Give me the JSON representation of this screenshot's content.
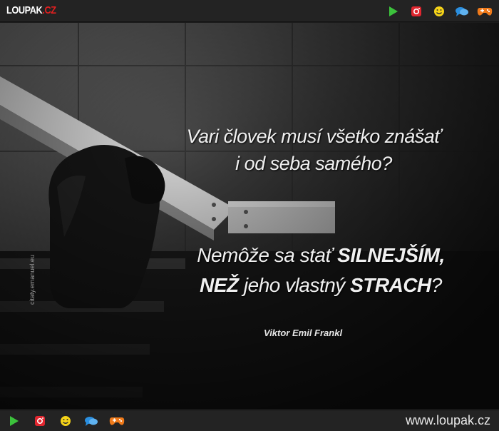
{
  "header": {
    "logo_main": "LOUPAK",
    "logo_suffix": ".CZ",
    "icons": [
      "play-icon",
      "instagram-icon",
      "smiley-icon",
      "chat-icon",
      "gamepad-icon"
    ]
  },
  "post": {
    "quote_line1": "Vari človek musí všetko znášať",
    "quote_line2": "i od seba samého?",
    "quote2_part1": "Nemôže sa stať ",
    "quote2_bold1": "SILNEJŠÍM,",
    "quote2_bold2": "NEŽ",
    "quote2_part2": " jeho vlastný ",
    "quote2_bold3": "STRACH",
    "quote2_end": "?",
    "author": "Viktor Emil Frankl",
    "watermark": "citaty.emanuel.eu"
  },
  "footer": {
    "site_url": "www.loupak.cz",
    "icons": [
      "play-icon",
      "instagram-icon",
      "smiley-icon",
      "chat-icon",
      "gamepad-icon"
    ]
  },
  "colors": {
    "bar_bg": "#232323",
    "accent_red": "#e32020",
    "play_green": "#3cc23c",
    "chat_blue": "#2a8fe0",
    "smiley_yellow": "#f5d318",
    "gamepad_orange": "#f07a1a"
  }
}
